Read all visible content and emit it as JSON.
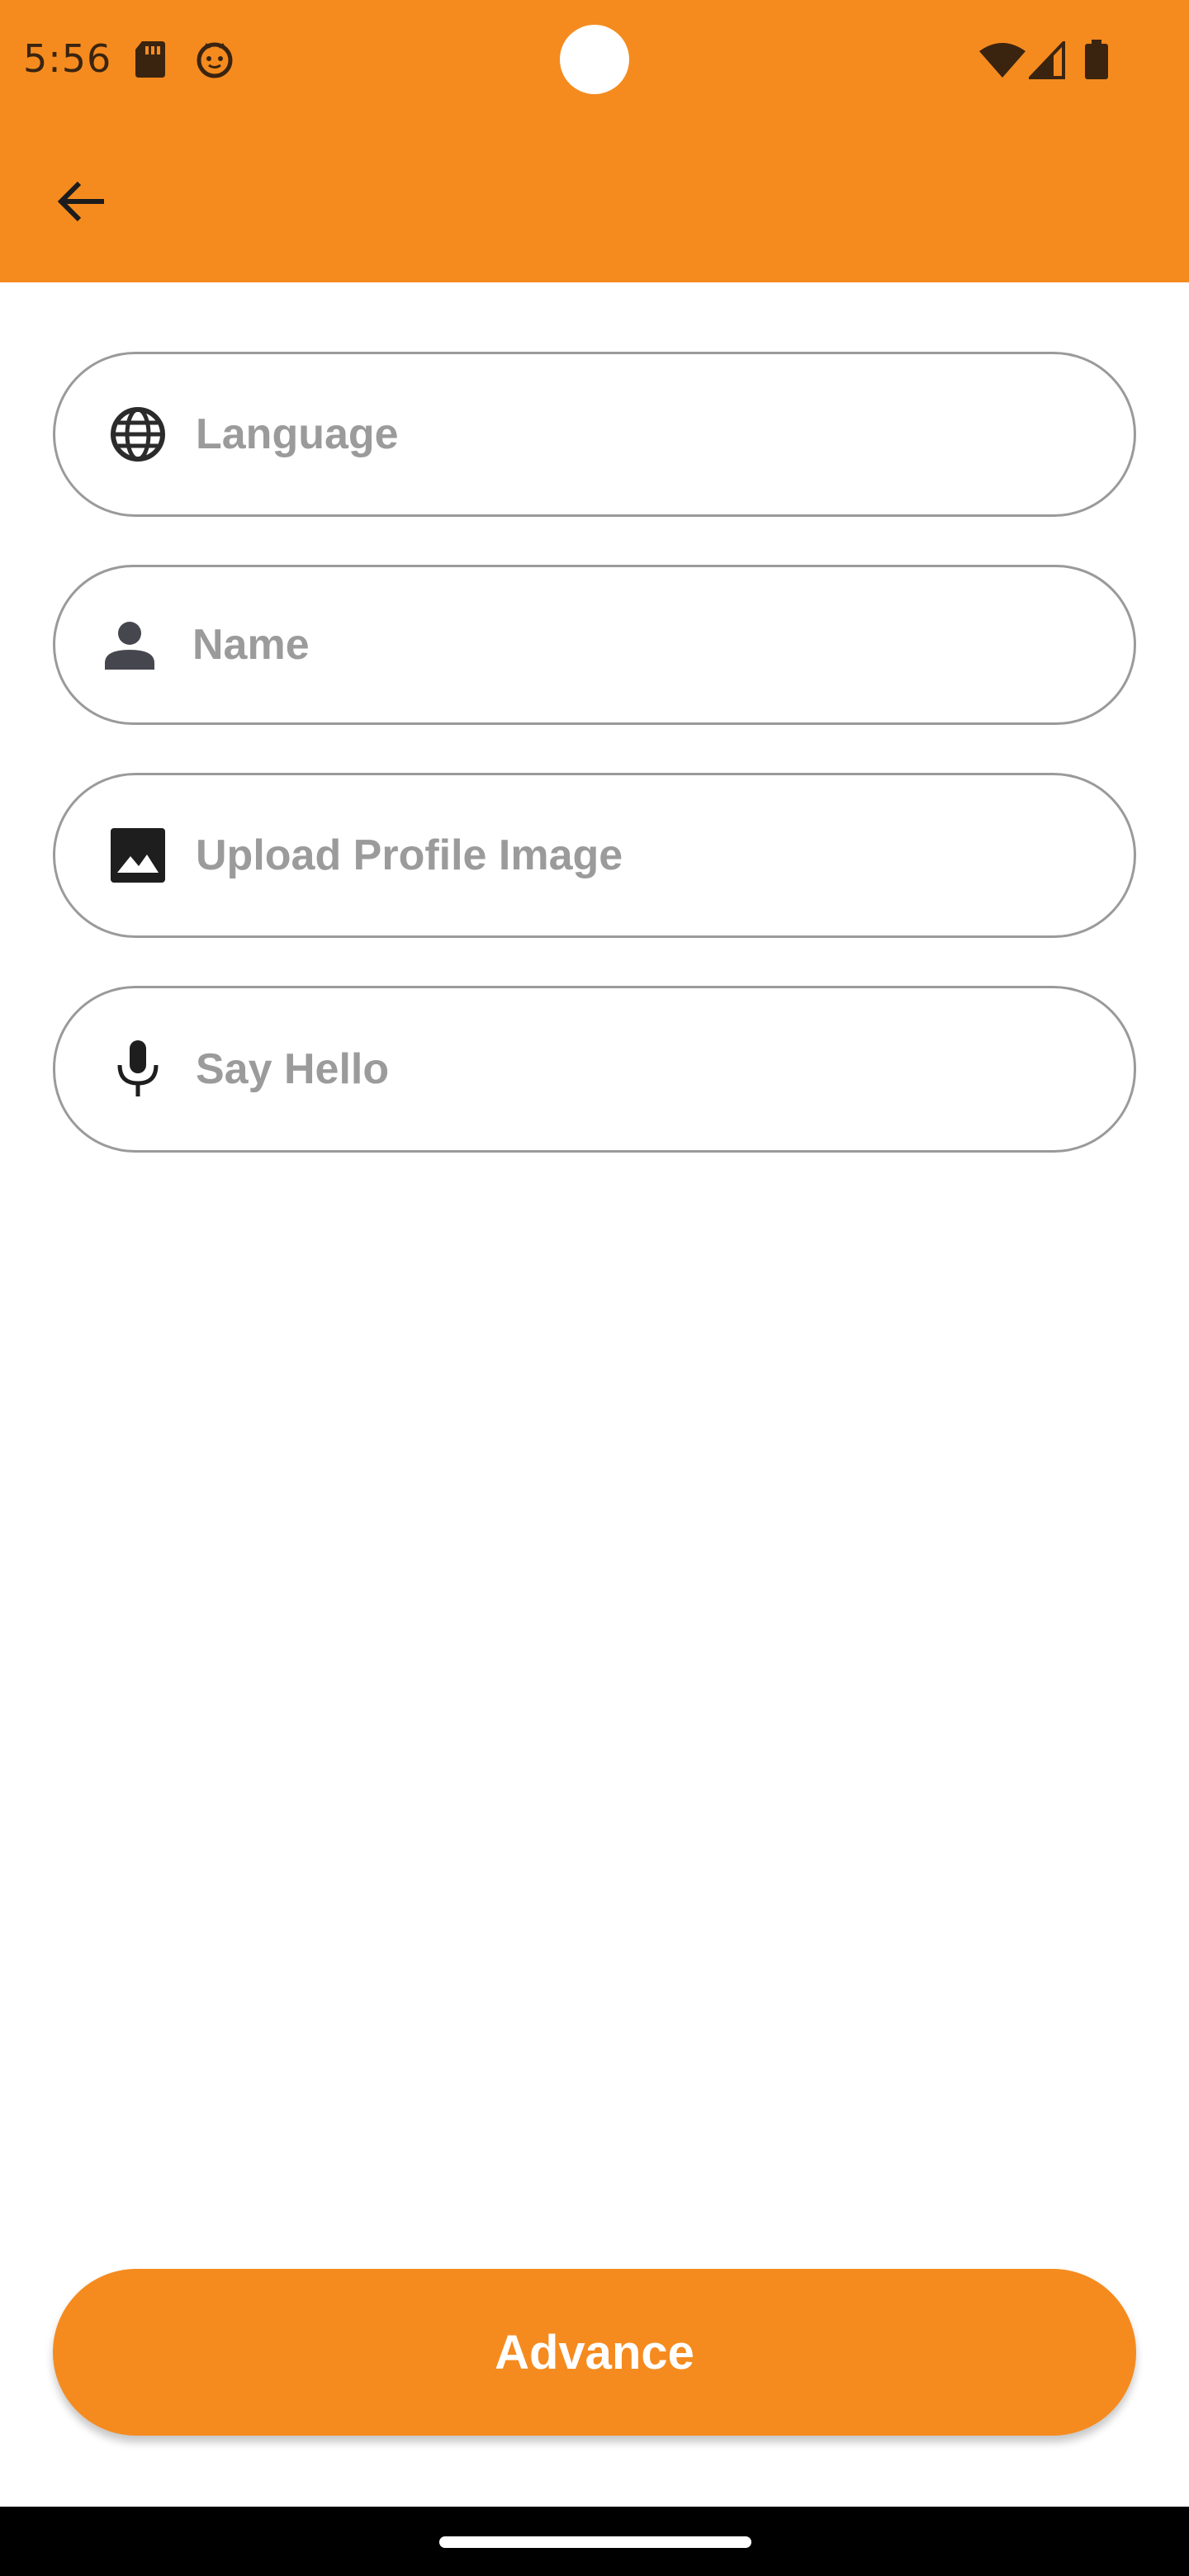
{
  "status_bar": {
    "time": "5:56",
    "left_icons": [
      "sd-card-icon",
      "cat-face-icon"
    ],
    "right_icons": [
      "wifi-icon",
      "signal-icon",
      "battery-icon"
    ]
  },
  "app_bar": {
    "back_icon": "arrow-back-icon"
  },
  "form": {
    "fields": [
      {
        "icon": "globe-icon",
        "placeholder": "Language"
      },
      {
        "icon": "person-icon",
        "placeholder": "Name"
      },
      {
        "icon": "image-icon",
        "placeholder": "Upload Profile Image"
      },
      {
        "icon": "mic-icon",
        "placeholder": "Say Hello"
      }
    ]
  },
  "actions": {
    "advance_label": "Advance"
  },
  "colors": {
    "accent": "#F58B1F",
    "field_border": "#9a9a9a",
    "placeholder_text": "#9b9b9b",
    "nav_bar": "#000000"
  }
}
